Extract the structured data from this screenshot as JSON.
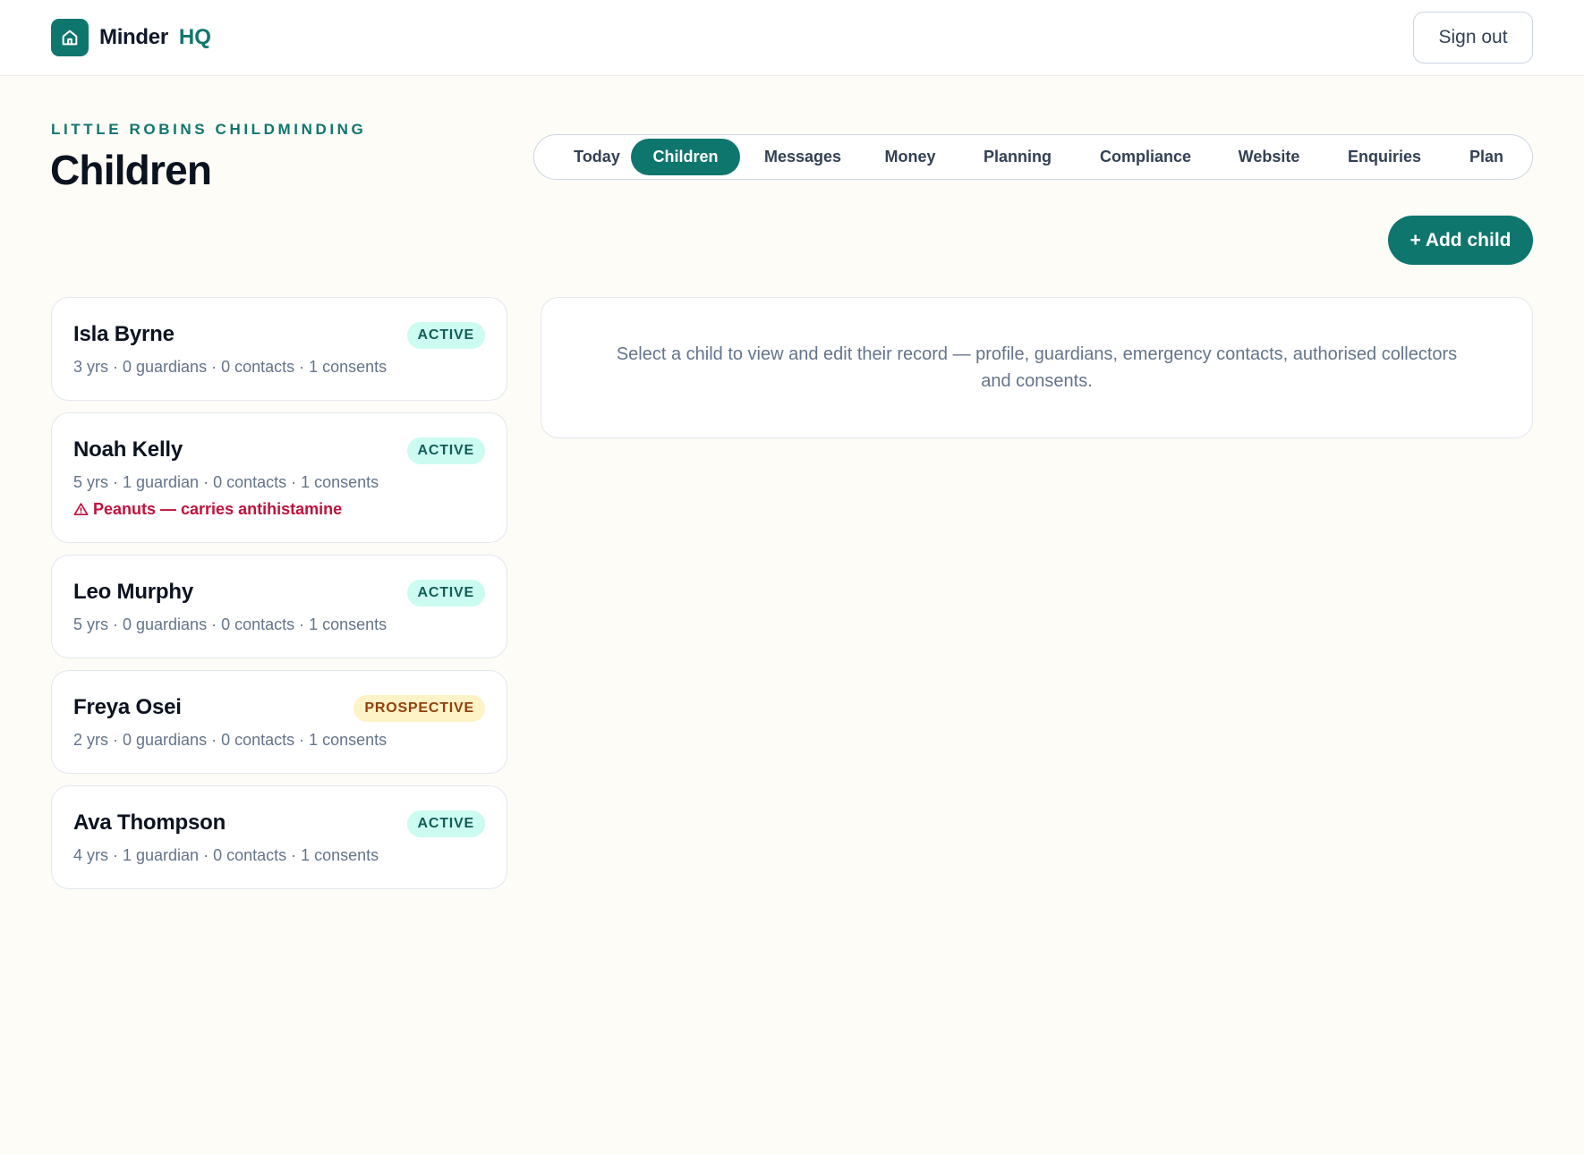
{
  "app": {
    "name": "Minder",
    "suffix": "HQ",
    "icon": "home-icon",
    "accent": "#0f766e"
  },
  "header": {
    "signout_label": "Sign out"
  },
  "page": {
    "eyebrow": "LITTLE ROBINS CHILDMINDING",
    "title": "Children"
  },
  "tabs": [
    {
      "label": "Today",
      "active": false
    },
    {
      "label": "Children",
      "active": true
    },
    {
      "label": "Messages",
      "active": false
    },
    {
      "label": "Money",
      "active": false
    },
    {
      "label": "Planning",
      "active": false
    },
    {
      "label": "Compliance",
      "active": false
    },
    {
      "label": "Website",
      "active": false
    },
    {
      "label": "Enquiries",
      "active": false
    },
    {
      "label": "Plan",
      "active": false
    }
  ],
  "actions": {
    "add_child_label": "+ Add child"
  },
  "children": [
    {
      "name": "Isla Byrne",
      "status": "ACTIVE",
      "meta": "3 yrs · 0 guardians · 0 contacts · 1 consents",
      "allergy": ""
    },
    {
      "name": "Noah Kelly",
      "status": "ACTIVE",
      "meta": "5 yrs · 1 guardian · 0 contacts · 1 consents",
      "allergy": "Peanuts — carries antihistamine"
    },
    {
      "name": "Leo Murphy",
      "status": "ACTIVE",
      "meta": "5 yrs · 0 guardians · 0 contacts · 1 consents",
      "allergy": ""
    },
    {
      "name": "Freya Osei",
      "status": "PROSPECTIVE",
      "meta": "2 yrs · 0 guardians · 0 contacts · 1 consents",
      "allergy": ""
    },
    {
      "name": "Ava Thompson",
      "status": "ACTIVE",
      "meta": "4 yrs · 1 guardian · 0 contacts · 1 consents",
      "allergy": ""
    }
  ],
  "detail": {
    "empty_text": "Select a child to view and edit their record — profile, guardians, emergency contacts, authorised collectors and consents."
  },
  "colors": {
    "background": "#fdfcf6",
    "active_badge_bg": "#ccfbf1",
    "prospective_badge_bg": "#fef3c7",
    "allergy": "#be123c"
  }
}
